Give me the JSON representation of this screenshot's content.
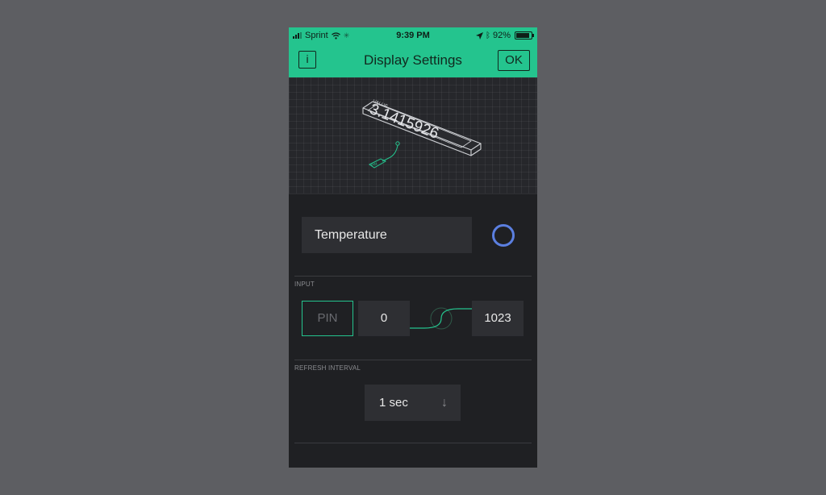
{
  "status_bar": {
    "carrier": "Sprint",
    "time": "9:39 PM",
    "battery": "92%"
  },
  "header": {
    "title": "Display Settings",
    "info_label": "i",
    "ok_label": "OK"
  },
  "preview": {
    "value_label": "VALUE",
    "value_text": "3.1415926",
    "pin_label": "PIN"
  },
  "name_field": {
    "value": "Temperature"
  },
  "colors": {
    "accent": "#24c48e",
    "widget_color": "#5b7fe0",
    "background": "#1f2023",
    "field": "#2e2f33"
  },
  "input_section": {
    "label": "INPUT",
    "pin_placeholder": "PIN",
    "min_value": "0",
    "max_value": "1023"
  },
  "refresh_section": {
    "label": "REFRESH INTERVAL",
    "selected": "1 sec",
    "arrow_icon": "arrow-down-icon"
  }
}
